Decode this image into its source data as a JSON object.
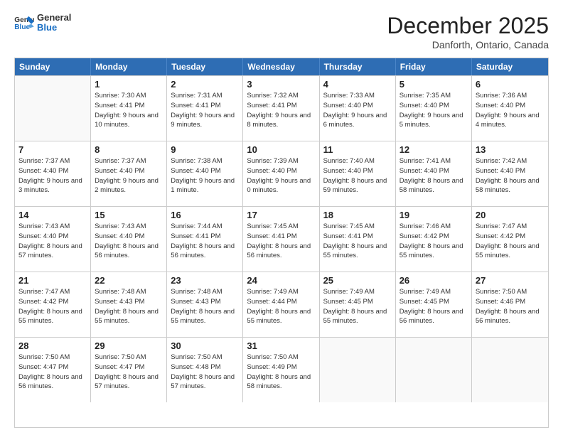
{
  "header": {
    "logo_line1": "General",
    "logo_line2": "Blue",
    "month": "December 2025",
    "location": "Danforth, Ontario, Canada"
  },
  "weekdays": [
    "Sunday",
    "Monday",
    "Tuesday",
    "Wednesday",
    "Thursday",
    "Friday",
    "Saturday"
  ],
  "weeks": [
    [
      {
        "day": "",
        "empty": true
      },
      {
        "day": "1",
        "sunrise": "7:30 AM",
        "sunset": "4:41 PM",
        "daylight": "9 hours and 10 minutes."
      },
      {
        "day": "2",
        "sunrise": "7:31 AM",
        "sunset": "4:41 PM",
        "daylight": "9 hours and 9 minutes."
      },
      {
        "day": "3",
        "sunrise": "7:32 AM",
        "sunset": "4:41 PM",
        "daylight": "9 hours and 8 minutes."
      },
      {
        "day": "4",
        "sunrise": "7:33 AM",
        "sunset": "4:40 PM",
        "daylight": "9 hours and 6 minutes."
      },
      {
        "day": "5",
        "sunrise": "7:35 AM",
        "sunset": "4:40 PM",
        "daylight": "9 hours and 5 minutes."
      },
      {
        "day": "6",
        "sunrise": "7:36 AM",
        "sunset": "4:40 PM",
        "daylight": "9 hours and 4 minutes."
      }
    ],
    [
      {
        "day": "7",
        "sunrise": "7:37 AM",
        "sunset": "4:40 PM",
        "daylight": "9 hours and 3 minutes."
      },
      {
        "day": "8",
        "sunrise": "7:37 AM",
        "sunset": "4:40 PM",
        "daylight": "9 hours and 2 minutes."
      },
      {
        "day": "9",
        "sunrise": "7:38 AM",
        "sunset": "4:40 PM",
        "daylight": "9 hours and 1 minute."
      },
      {
        "day": "10",
        "sunrise": "7:39 AM",
        "sunset": "4:40 PM",
        "daylight": "9 hours and 0 minutes."
      },
      {
        "day": "11",
        "sunrise": "7:40 AM",
        "sunset": "4:40 PM",
        "daylight": "8 hours and 59 minutes."
      },
      {
        "day": "12",
        "sunrise": "7:41 AM",
        "sunset": "4:40 PM",
        "daylight": "8 hours and 58 minutes."
      },
      {
        "day": "13",
        "sunrise": "7:42 AM",
        "sunset": "4:40 PM",
        "daylight": "8 hours and 58 minutes."
      }
    ],
    [
      {
        "day": "14",
        "sunrise": "7:43 AM",
        "sunset": "4:40 PM",
        "daylight": "8 hours and 57 minutes."
      },
      {
        "day": "15",
        "sunrise": "7:43 AM",
        "sunset": "4:40 PM",
        "daylight": "8 hours and 56 minutes."
      },
      {
        "day": "16",
        "sunrise": "7:44 AM",
        "sunset": "4:41 PM",
        "daylight": "8 hours and 56 minutes."
      },
      {
        "day": "17",
        "sunrise": "7:45 AM",
        "sunset": "4:41 PM",
        "daylight": "8 hours and 56 minutes."
      },
      {
        "day": "18",
        "sunrise": "7:45 AM",
        "sunset": "4:41 PM",
        "daylight": "8 hours and 55 minutes."
      },
      {
        "day": "19",
        "sunrise": "7:46 AM",
        "sunset": "4:42 PM",
        "daylight": "8 hours and 55 minutes."
      },
      {
        "day": "20",
        "sunrise": "7:47 AM",
        "sunset": "4:42 PM",
        "daylight": "8 hours and 55 minutes."
      }
    ],
    [
      {
        "day": "21",
        "sunrise": "7:47 AM",
        "sunset": "4:42 PM",
        "daylight": "8 hours and 55 minutes."
      },
      {
        "day": "22",
        "sunrise": "7:48 AM",
        "sunset": "4:43 PM",
        "daylight": "8 hours and 55 minutes."
      },
      {
        "day": "23",
        "sunrise": "7:48 AM",
        "sunset": "4:43 PM",
        "daylight": "8 hours and 55 minutes."
      },
      {
        "day": "24",
        "sunrise": "7:49 AM",
        "sunset": "4:44 PM",
        "daylight": "8 hours and 55 minutes."
      },
      {
        "day": "25",
        "sunrise": "7:49 AM",
        "sunset": "4:45 PM",
        "daylight": "8 hours and 55 minutes."
      },
      {
        "day": "26",
        "sunrise": "7:49 AM",
        "sunset": "4:45 PM",
        "daylight": "8 hours and 56 minutes."
      },
      {
        "day": "27",
        "sunrise": "7:50 AM",
        "sunset": "4:46 PM",
        "daylight": "8 hours and 56 minutes."
      }
    ],
    [
      {
        "day": "28",
        "sunrise": "7:50 AM",
        "sunset": "4:47 PM",
        "daylight": "8 hours and 56 minutes."
      },
      {
        "day": "29",
        "sunrise": "7:50 AM",
        "sunset": "4:47 PM",
        "daylight": "8 hours and 57 minutes."
      },
      {
        "day": "30",
        "sunrise": "7:50 AM",
        "sunset": "4:48 PM",
        "daylight": "8 hours and 57 minutes."
      },
      {
        "day": "31",
        "sunrise": "7:50 AM",
        "sunset": "4:49 PM",
        "daylight": "8 hours and 58 minutes."
      },
      {
        "day": "",
        "empty": true
      },
      {
        "day": "",
        "empty": true
      },
      {
        "day": "",
        "empty": true
      }
    ]
  ]
}
